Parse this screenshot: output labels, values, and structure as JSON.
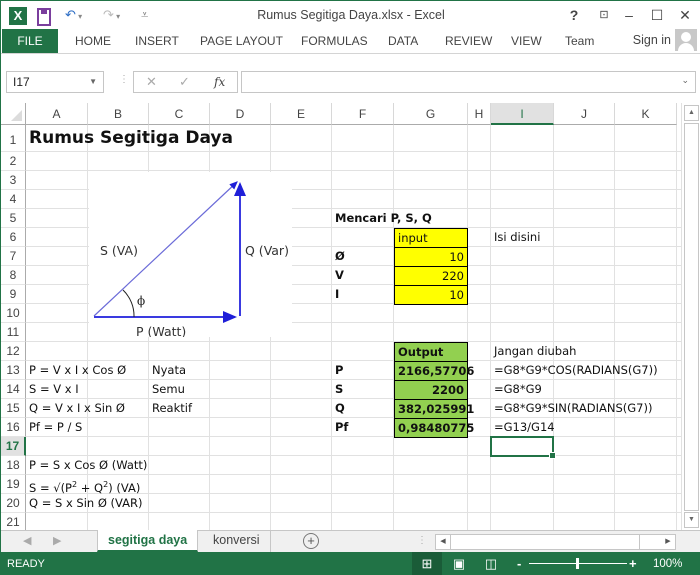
{
  "window": {
    "title": "Rumus Segitiga Daya.xlsx - Excel",
    "app_icon": "excel-logo-icon",
    "help": "?",
    "controls": [
      "ribbon-display-icon",
      "minimize-icon",
      "maximize-icon",
      "close-icon"
    ]
  },
  "ribbon": {
    "tabs": [
      "FILE",
      "HOME",
      "INSERT",
      "PAGE LAYOUT",
      "FORMULAS",
      "DATA",
      "REVIEW",
      "VIEW",
      "Team"
    ],
    "sign_in": "Sign in"
  },
  "formula_bar": {
    "name_box": "I17",
    "fx_label": "fx",
    "formula": ""
  },
  "grid": {
    "columns": [
      "A",
      "B",
      "C",
      "D",
      "E",
      "F",
      "G",
      "H",
      "I",
      "J",
      "K"
    ],
    "selected_column": "I",
    "rows": [
      "1",
      "2",
      "3",
      "4",
      "5",
      "6",
      "7",
      "8",
      "9",
      "10",
      "11",
      "12",
      "13",
      "14",
      "15",
      "16",
      "17",
      "18",
      "19",
      "20",
      "21"
    ],
    "selected_row": "17",
    "selected_cell": "I17"
  },
  "cells": {
    "A1": "Rumus Segitiga Daya",
    "F5": "Mencari P, S, Q",
    "G6": "input",
    "I6": "Isi disini",
    "F7": "Ø",
    "G7": "10",
    "F8": "V",
    "G8": "220",
    "F9": "I",
    "G9": "10",
    "G12": "Output",
    "I12": "Jangan diubah",
    "A13": "P = V x I x Cos Ø",
    "C13": "Nyata",
    "F13": "P",
    "G13": "2166,57706",
    "I13": "=G8*G9*COS(RADIANS(G7))",
    "A14": "S = V x I",
    "C14": "Semu",
    "F14": "S",
    "G14": "2200",
    "I14": "=G8*G9",
    "A15": "Q = V x I x Sin Ø",
    "C15": "Reaktif",
    "F15": "Q",
    "G15": "382,025991",
    "I15": "=G8*G9*SIN(RADIANS(G7))",
    "A16": "Pf = P / S",
    "F16": "Pf",
    "G16": "0,98480775",
    "I16": "=G13/G14",
    "A18": "P = S x Cos Ø   (Watt)",
    "A19_pre": "S = √(P",
    "A19_mid": " + Q",
    "A19_post": ")   (VA)",
    "A19_sup": "2",
    "A20": "Q = S x Sin Ø    (VAR)"
  },
  "diagram": {
    "hypotenuse_label": "S (VA)",
    "vertical_label": "Q (Var)",
    "base_label": "P (Watt)",
    "angle_label": "ϕ",
    "line_color": "#4a4ae0"
  },
  "sheets": {
    "tabs": [
      "segitiga daya",
      "konversi"
    ],
    "active": "segitiga daya"
  },
  "status": {
    "text": "READY",
    "zoom": "100%",
    "zoom_minus": "-",
    "zoom_plus": "+"
  },
  "colors": {
    "excel_green": "#217346",
    "input_fill": "#ffff00",
    "output_fill": "#92d050"
  }
}
